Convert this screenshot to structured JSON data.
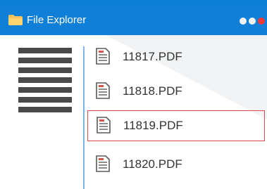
{
  "window": {
    "title": "File Explorer",
    "colors": {
      "titlebar": "#0f7fd8",
      "background_accent": "#0d7ed6",
      "selection_border": "#e0484f",
      "close_dot": "#f03a3a"
    }
  },
  "titlebar": {
    "icon": "folder-icon",
    "controls": [
      "minimize-dot",
      "maximize-dot",
      "close-dot"
    ]
  },
  "sidebar": {
    "icon": "hamburger-menu-icon"
  },
  "files": [
    {
      "name": "11817.PDF",
      "icon": "document-icon",
      "selected": false
    },
    {
      "name": "11818.PDF",
      "icon": "document-icon",
      "selected": false
    },
    {
      "name": "11819.PDF",
      "icon": "document-icon",
      "selected": true
    },
    {
      "name": "11820.PDF",
      "icon": "document-icon",
      "selected": false
    }
  ]
}
